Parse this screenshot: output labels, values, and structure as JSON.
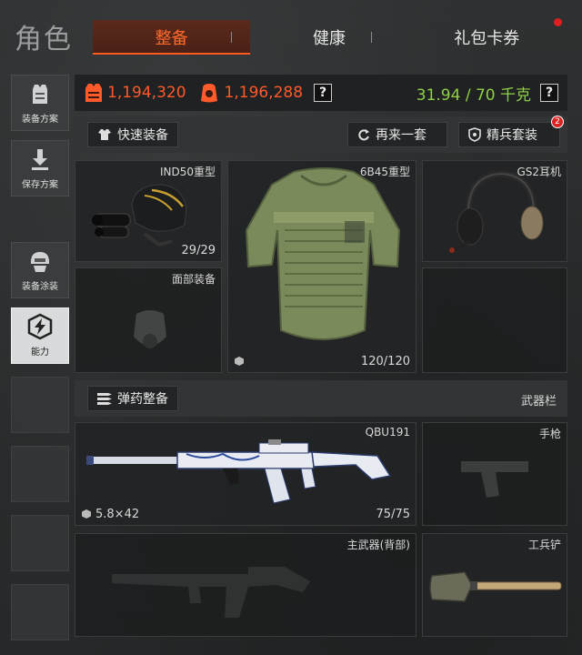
{
  "page_title": "角色",
  "tabs": [
    {
      "label": "整备",
      "active": true
    },
    {
      "label": "健康",
      "active": false
    },
    {
      "label": "礼包卡券",
      "active": false,
      "has_notification": true
    }
  ],
  "sidebar": {
    "items": [
      {
        "label": "装备方案",
        "icon": "vest-icon"
      },
      {
        "label": "保存方案",
        "icon": "download-icon"
      },
      {
        "label": "装备涂装",
        "icon": "helmet-paint-icon"
      },
      {
        "label": "能力",
        "icon": "lightning-shield-icon",
        "active": true
      }
    ]
  },
  "stats": {
    "armor_value": "1,194,320",
    "helmet_value": "1,196,288",
    "help_1": "?",
    "weight": "31.94 / 70 千克",
    "help_2": "?"
  },
  "actions": {
    "quick_equip": "快速装备",
    "reequip": "再来一套",
    "elite_set": "精兵套装",
    "elite_badge": "2"
  },
  "slots": {
    "helmet": {
      "name": "IND50重型",
      "durability": "29/29"
    },
    "armor": {
      "name": "6B45重型",
      "durability": "120/120"
    },
    "headset": {
      "name": "GS2耳机"
    },
    "face": {
      "name": "面部装备"
    }
  },
  "ammo_bar": {
    "ammo_equip": "弹药整备",
    "weapons_label": "武器栏"
  },
  "weapons": {
    "primary": {
      "name": "QBU191",
      "ammo_type": "5.8×42",
      "ammo_count": "75/75"
    },
    "pistol": {
      "name": "手枪"
    },
    "secondary": {
      "name": "主武器(背部)"
    },
    "melee": {
      "name": "工兵铲"
    }
  },
  "colors": {
    "accent": "#ff5a1f",
    "weight": "#8fd046",
    "value": "#ff5a2a"
  }
}
